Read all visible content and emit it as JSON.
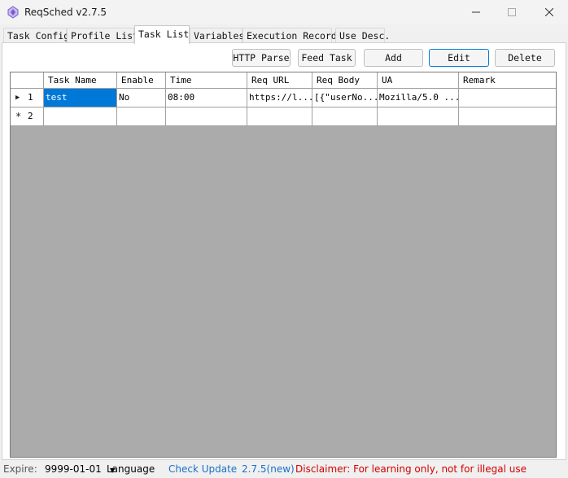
{
  "window": {
    "title": "ReqSched v2.7.5"
  },
  "tabs": [
    {
      "label": "Task Config"
    },
    {
      "label": "Profile List"
    },
    {
      "label": "Task List"
    },
    {
      "label": "Variables"
    },
    {
      "label": "Execution Records"
    },
    {
      "label": "Use Desc."
    }
  ],
  "toolbar": {
    "http_parse": "HTTP Parse",
    "feed_task": "Feed Task",
    "add": "Add",
    "edit": "Edit",
    "delete": "Delete"
  },
  "grid": {
    "columns": [
      "Task Name",
      "Enable",
      "Time",
      "Req URL",
      "Req Body",
      "UA",
      "Remark"
    ],
    "rows": [
      {
        "num": "1",
        "cells": [
          "test",
          "No",
          "08:00",
          "https://l...",
          "[{\"userNo...",
          "Mozilla/5.0 ...",
          ""
        ]
      },
      {
        "num": "2",
        "cells": [
          "",
          "",
          "",
          "",
          "",
          "",
          ""
        ]
      }
    ]
  },
  "status": {
    "expire_label": "Expire:",
    "expire_value": "9999-01-01",
    "language": "Language",
    "check_update": "Check Update",
    "version": "2.7.5(new)",
    "disclaimer": "Disclaimer: For learning only, not for illegal use"
  },
  "colors": {
    "selection": "#0078d7",
    "grid_background": "#ababab",
    "link": "#1a6fc9",
    "disclaimer": "#d40000"
  }
}
